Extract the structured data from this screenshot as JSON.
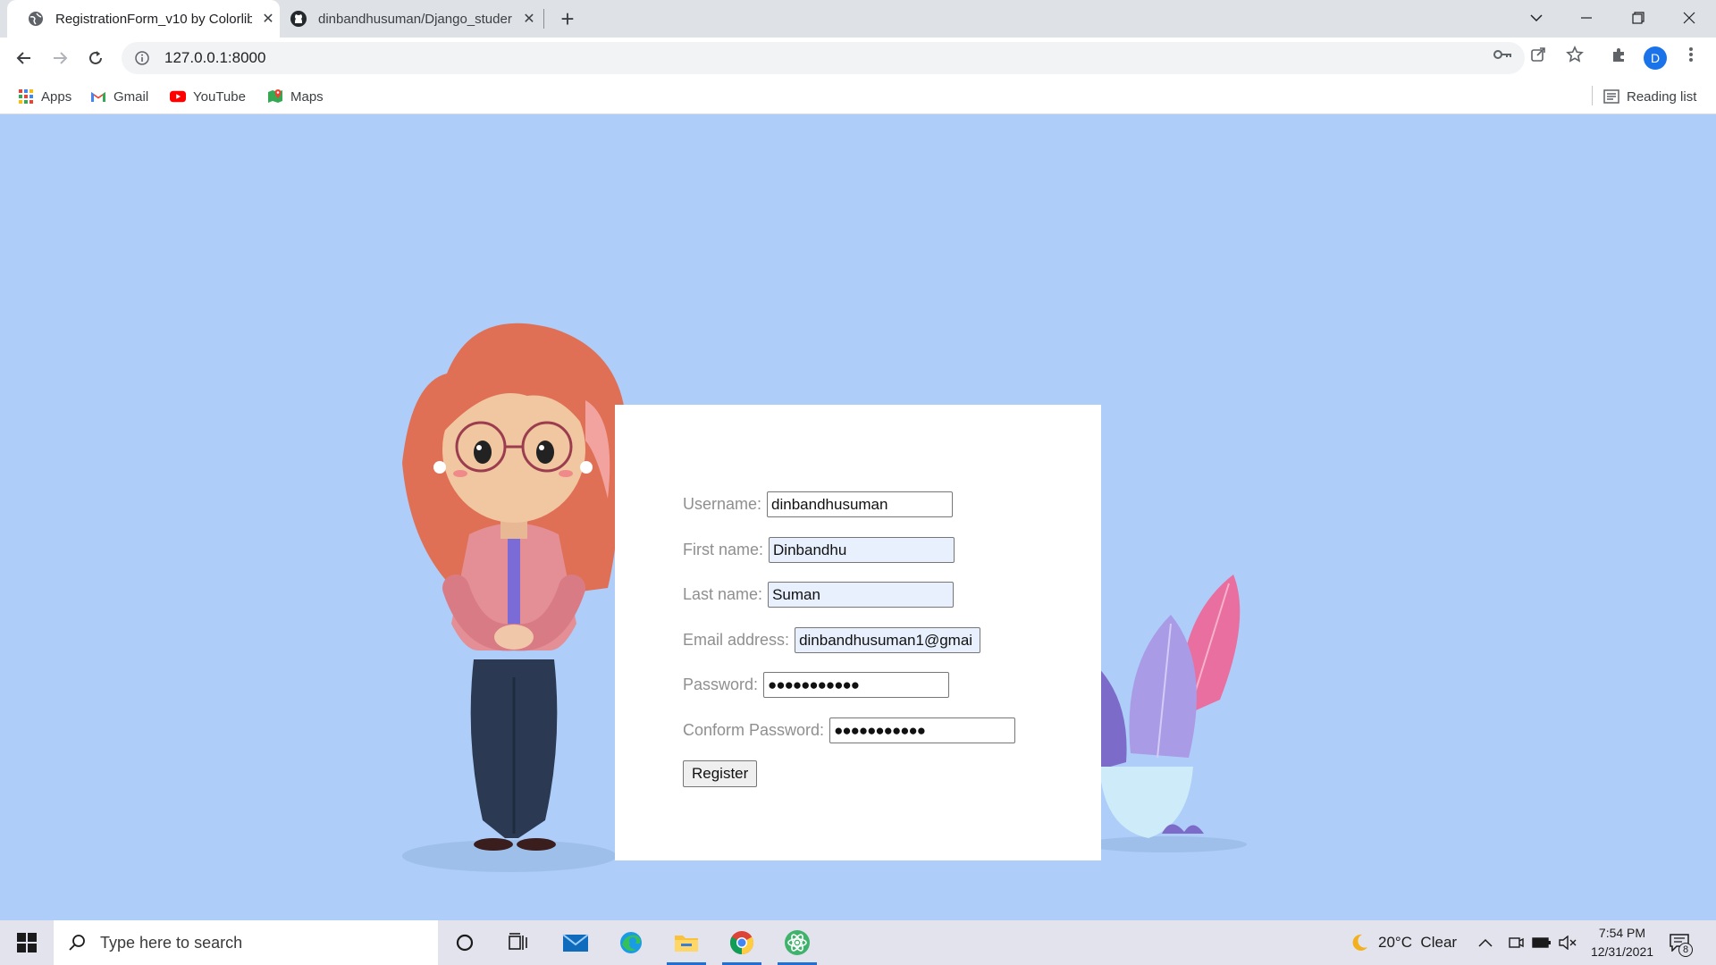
{
  "browser": {
    "tabs": [
      {
        "title": "RegistrationForm_v10 by Colorlib",
        "icon": "globe-icon",
        "active": true
      },
      {
        "title": "dinbandhusuman/Django_studer",
        "icon": "github-icon",
        "active": false
      }
    ],
    "url": "127.0.0.1:8000",
    "profile_initial": "D",
    "bookmarks": [
      {
        "label": "Apps",
        "icon": "apps-grid-icon"
      },
      {
        "label": "Gmail",
        "icon": "gmail-icon"
      },
      {
        "label": "YouTube",
        "icon": "youtube-icon"
      },
      {
        "label": "Maps",
        "icon": "maps-icon"
      }
    ],
    "reading_list": "Reading list"
  },
  "form": {
    "username_label": "Username:",
    "username_value": "dinbandhusuman",
    "first_name_label": "First name:",
    "first_name_value": "Dinbandhu",
    "last_name_label": "Last name:",
    "last_name_value": "Suman",
    "email_label": "Email address:",
    "email_value": "dinbandhusuman1@gmai",
    "password_label": "Password:",
    "password_value": "●●●●●●●●●●●",
    "confirm_label": "Conform Password:",
    "confirm_value": "●●●●●●●●●●●",
    "register_label": "Register"
  },
  "taskbar": {
    "search_placeholder": "Type here to search",
    "weather": "20°C  Clear",
    "time": "7:54 PM",
    "date": "12/31/2021",
    "notification_count": "8"
  },
  "colors": {
    "page_background": "#aecdf8",
    "autofill_background": "#e8f0fe",
    "accent": "#1a73e8"
  }
}
